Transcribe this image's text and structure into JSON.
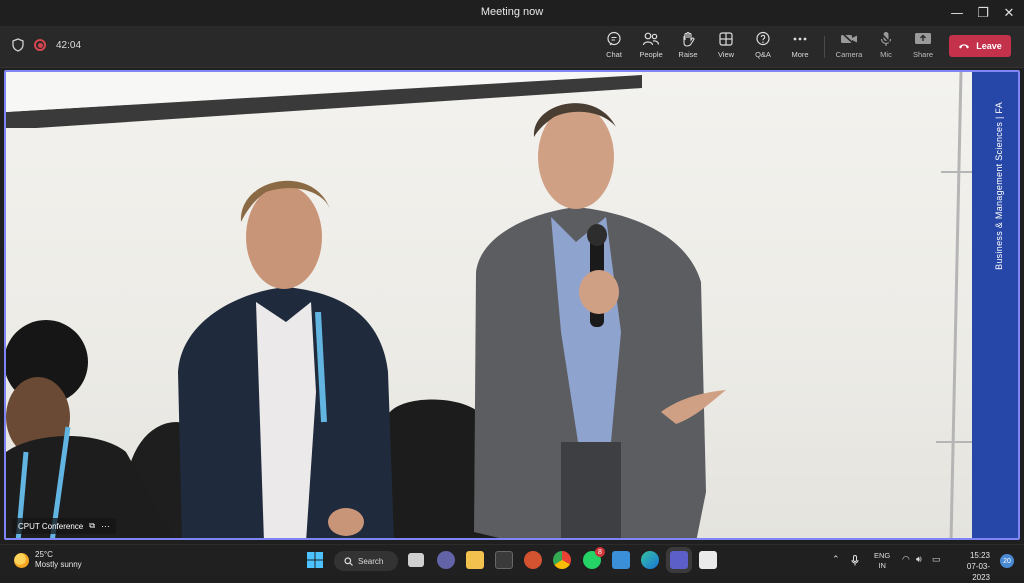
{
  "window": {
    "title": "Meeting now"
  },
  "meeting": {
    "elapsed": "42:04",
    "controls": [
      {
        "name": "chat-button",
        "icon": "chat-icon",
        "label": "Chat"
      },
      {
        "name": "people-button",
        "icon": "people-icon",
        "label": "People"
      },
      {
        "name": "raise-button",
        "icon": "hand-icon",
        "label": "Raise"
      },
      {
        "name": "view-button",
        "icon": "grid-icon",
        "label": "View"
      },
      {
        "name": "qa-button",
        "icon": "qa-icon",
        "label": "Q&A"
      },
      {
        "name": "more-button",
        "icon": "more-icon",
        "label": "More"
      },
      {
        "name": "camera-button",
        "icon": "camera-off-icon",
        "label": "Camera"
      },
      {
        "name": "mic-button",
        "icon": "mic-off-icon",
        "label": "Mic"
      },
      {
        "name": "share-button",
        "icon": "share-icon",
        "label": "Share"
      }
    ],
    "leave_label": "Leave",
    "participant_name": "CPUT Conference",
    "banner_text": "Business & Management Sciences  |  FA"
  },
  "taskbar": {
    "weather": {
      "temp": "25°C",
      "condition": "Mostly sunny"
    },
    "search_label": "Search",
    "whatsapp_badge": "8",
    "language": {
      "line1": "ENG",
      "line2": "IN"
    },
    "time": "15:23",
    "date": "07-03-2023",
    "notifications": "20"
  },
  "colors": {
    "accent": "#7f85f5",
    "leave": "#c4314b",
    "record": "#d64550"
  }
}
